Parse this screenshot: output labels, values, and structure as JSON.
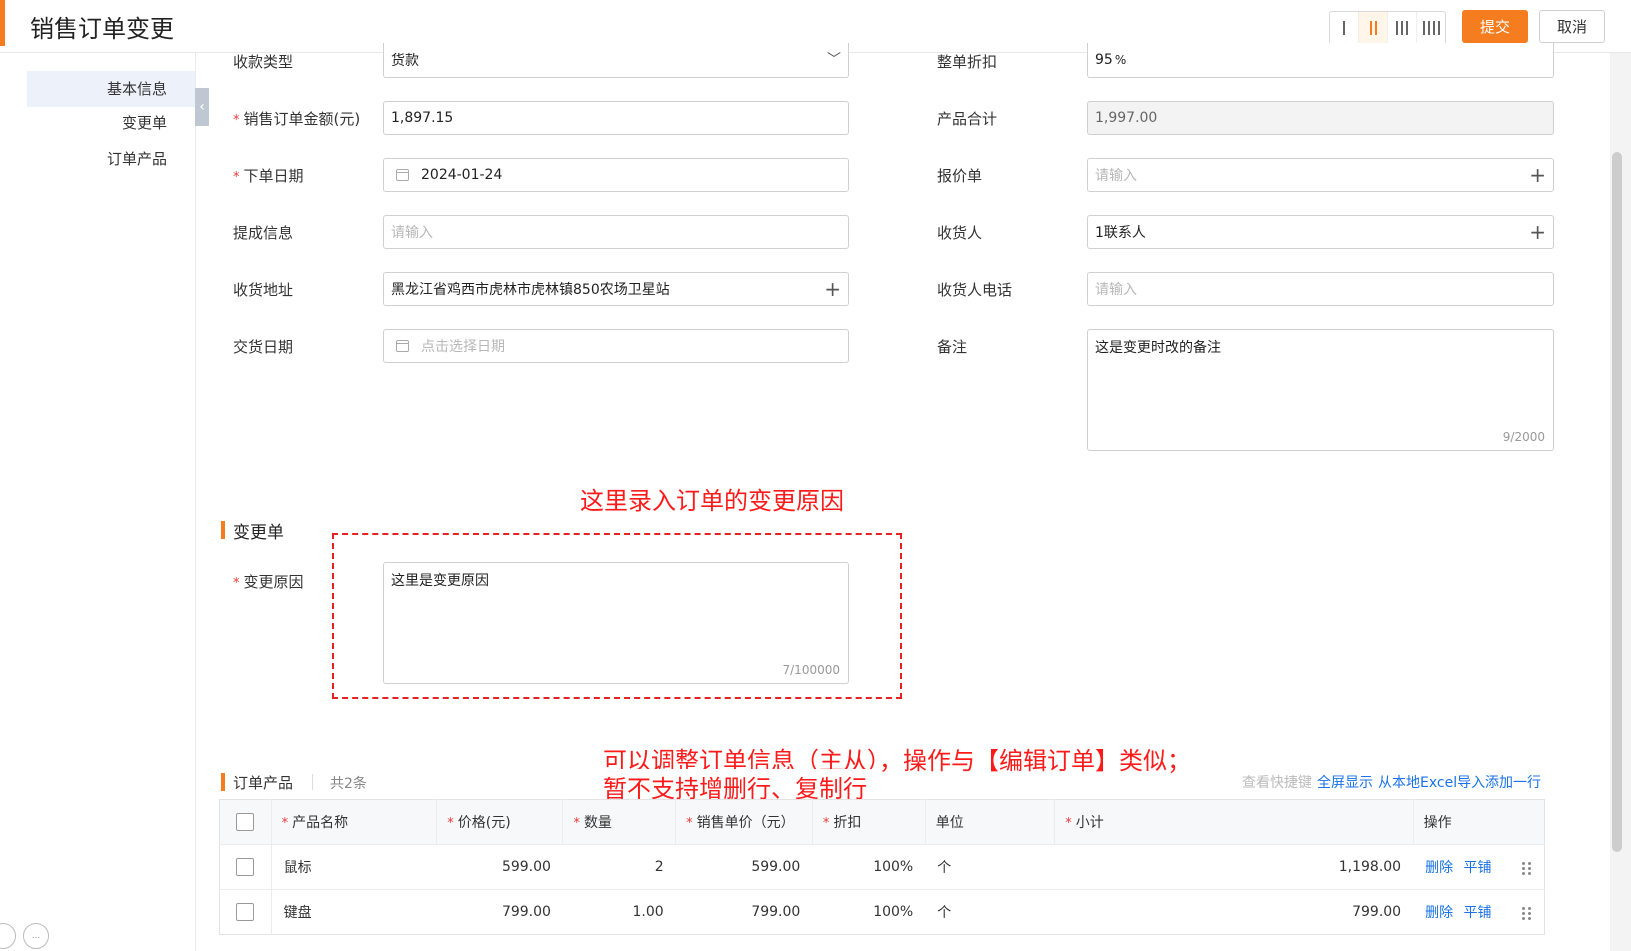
{
  "header": {
    "title": "销售订单变更",
    "submit_label": "提交",
    "cancel_label": "取消",
    "accent_color": "#f57c1f"
  },
  "sidebar": {
    "items": [
      {
        "label": "基本信息",
        "active": true
      },
      {
        "label": "变更单",
        "active": false
      },
      {
        "label": "订单产品",
        "active": false
      }
    ]
  },
  "form": {
    "payment_type": {
      "label": "收款类型",
      "value": "货款"
    },
    "order_amount": {
      "label": "销售订单金额(元)",
      "value": "1,897.15"
    },
    "order_date": {
      "label": "下单日期",
      "value": "2024-01-24"
    },
    "commission": {
      "label": "提成信息",
      "placeholder": "请输入"
    },
    "ship_address": {
      "label": "收货地址",
      "value": "黑龙江省鸡西市虎林市虎林镇850农场卫星站"
    },
    "delivery_date": {
      "label": "交货日期",
      "placeholder": "点击选择日期"
    },
    "discount": {
      "label": "整单折扣",
      "value": "95",
      "unit": "%"
    },
    "product_total": {
      "label": "产品合计",
      "value": "1,997.00"
    },
    "quote": {
      "label": "报价单",
      "placeholder": "请输入"
    },
    "consignee": {
      "label": "收货人",
      "value": "1联系人"
    },
    "consignee_phone": {
      "label": "收货人电话",
      "placeholder": "请输入"
    },
    "remark": {
      "label": "备注",
      "value": "这是变更时改的备注",
      "counter": "9/2000"
    }
  },
  "change_section": {
    "title": "变更单",
    "reason_label": "变更原因",
    "reason_value": "这里是变更原因",
    "reason_counter": "7/100000"
  },
  "annotations": {
    "top": "这里录入订单的变更原因",
    "bottom_line1": "可以调整订单信息（主从），操作与【编辑订单】类似；",
    "bottom_line2": "暂不支持增删行、复制行",
    "color": "#ff1a1a"
  },
  "products": {
    "title": "订单产品",
    "count": "共2条",
    "actions": [
      "查看快捷键",
      "全屏显示",
      "从本地Excel导入",
      "添加一行"
    ],
    "columns": [
      "产品名称",
      "价格(元)",
      "数量",
      "销售单价（元）",
      "折扣",
      "单位",
      "小计",
      "操作"
    ],
    "rows": [
      {
        "name": "鼠标",
        "price": "599.00",
        "qty": "2",
        "unit_price": "599.00",
        "discount": "100%",
        "unit": "个",
        "subtotal": "1,198.00"
      },
      {
        "name": "键盘",
        "price": "799.00",
        "qty": "1.00",
        "unit_price": "799.00",
        "discount": "100%",
        "unit": "个",
        "subtotal": "799.00"
      }
    ],
    "row_actions": [
      "删除",
      "平铺"
    ]
  },
  "footer": {
    "more_label": "..."
  }
}
